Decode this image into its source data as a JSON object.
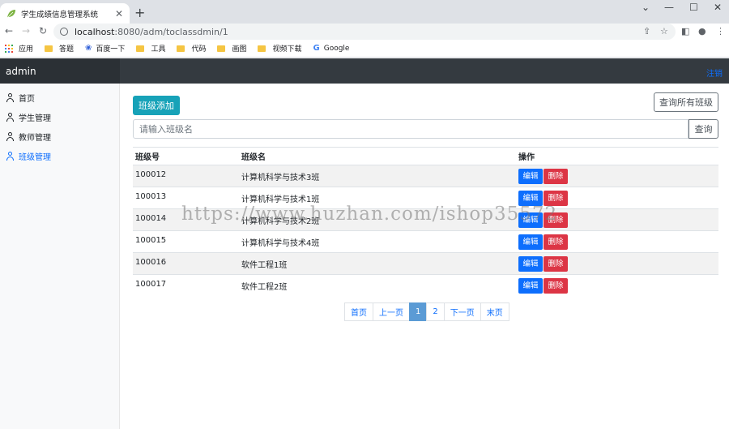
{
  "browser": {
    "tab_title": "学生成绩信息管理系统",
    "url_host": "localhost",
    "url_rest": ":8080/adm/toclassdmin/1",
    "bookmarks": [
      {
        "label": "应用",
        "icon": "apps-grid-icon"
      },
      {
        "label": "答题",
        "icon": "folder-icon"
      },
      {
        "label": "百度一下",
        "icon": "baidu-paw-icon"
      },
      {
        "label": "工具",
        "icon": "folder-icon"
      },
      {
        "label": "代码",
        "icon": "folder-icon"
      },
      {
        "label": "画图",
        "icon": "folder-icon"
      },
      {
        "label": "视频下载",
        "icon": "folder-icon"
      },
      {
        "label": "Google",
        "icon": "google-icon"
      }
    ]
  },
  "app": {
    "brand": "admin",
    "logout": "注销",
    "sidebar": [
      {
        "label": "首页",
        "active": false
      },
      {
        "label": "学生管理",
        "active": false
      },
      {
        "label": "教师管理",
        "active": false
      },
      {
        "label": "班级管理",
        "active": true
      }
    ]
  },
  "main": {
    "add_button": "班级添加",
    "query_all_button": "查询所有班级",
    "search_placeholder": "请输入班级名",
    "search_button": "查询",
    "table": {
      "headers": [
        "班级号",
        "班级名",
        "操作"
      ],
      "rows": [
        {
          "id": "100012",
          "name": "计算机科学与技术3班"
        },
        {
          "id": "100013",
          "name": "计算机科学与技术1班"
        },
        {
          "id": "100014",
          "name": "计算机科学与技术2班"
        },
        {
          "id": "100015",
          "name": "计算机科学与技术4班"
        },
        {
          "id": "100016",
          "name": "软件工程1班"
        },
        {
          "id": "100017",
          "name": "软件工程2班"
        }
      ],
      "edit_label": "编辑",
      "delete_label": "删除"
    },
    "pagination": {
      "first": "首页",
      "prev": "上一页",
      "pages": [
        "1",
        "2"
      ],
      "current": "1",
      "next": "下一页",
      "last": "末页"
    }
  },
  "watermark": "https://www.huzhan.com/ishop35572"
}
